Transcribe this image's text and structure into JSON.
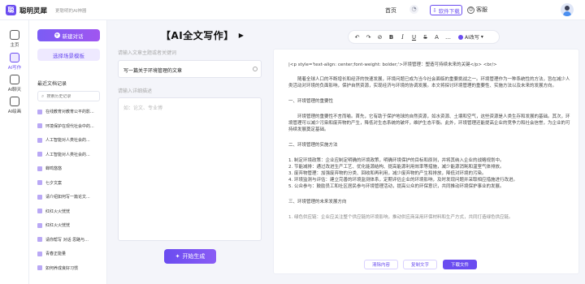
{
  "app": {
    "logo_char": "聪",
    "name": "聪明灵犀",
    "slogan": "更聪明的AI神器"
  },
  "topbar": {
    "home": "首页",
    "download": "软件下载",
    "kefu": "客服"
  },
  "rail": [
    {
      "label": "主页",
      "icon": "home-icon"
    },
    {
      "label": "AI写作",
      "icon": "pen-icon"
    },
    {
      "label": "AI聊天",
      "icon": "chat-icon"
    },
    {
      "label": "AI绘画",
      "icon": "paint-icon"
    }
  ],
  "history": {
    "new_chat": "新建对话",
    "choose_template": "选择场景模板",
    "title": "最近文档记录",
    "search_placeholder": "搜索历史记录",
    "items": [
      "在线教育对教育公平的影...",
      "环境保护在现代社会中的...",
      "人工智能对人类社会的...",
      "人工智能对人类社会的...",
      "蝉鸣悠悠",
      "七夕文案",
      "请介绍如何写一篇论文...",
      "红红火火恍恍",
      "红红火火恍恍",
      "请你帮写 对话 思路与...",
      "青春正能量",
      "如何养成良好习惯"
    ]
  },
  "main": {
    "title": "【AI全文写作】",
    "topic_label": "请输入文章主题或者关键词",
    "topic_value": "写一篇关于环境管理的文章",
    "desc_label": "请输入详细描述",
    "desc_placeholder": "如：论文、专业博",
    "generate": "开始生成"
  },
  "toolbar": {
    "ai_label": "AI改写"
  },
  "editor": {
    "code_line": "|<p style='text-align: center;font-weight: bolder;'>环境管理：塑造可持续未来的关键</p> <br/>",
    "paragraphs": [
      "随着全球人口的不断增长和经济的快速发展，环境问题已成为当今社会面临的重要挑战之一。环境管理作为一种系统性的方法，旨在减少人类活动对环境的负面影响，保护自然资源，实现经济与环境的协调发展。本文将探讨环境管理的重要性、实施方法以及未来的发展方向。"
    ],
    "heading1": "一、环境管理的重要性",
    "paragraph2": "环境管理的重要性不言而喻。首先，它有助于保护地球的自然资源，如水资源、土壤和空气，这些资源是人类生存和发展的基础。其次，环境管理可以减少污染和废弃物的产生，降低对生态系统的破坏，维护生态平衡。此外，环境管理还能提高企业的竞争力和社会信誉，为企业的可持续发展奠定基础。",
    "heading2": "二、环境管理的实施方法",
    "list": [
      "1. 制定环境政策：企业应制定明确的环境政策，明确环境保护的目标和原则，并将其纳入企业的战略规划中。",
      "2. 节能减排：通过改进生产工艺、优化能源结构、提高能源利用效率等措施，减少能源消耗和温室气体排放。",
      "3. 废弃物管理：加强废弃物的分类、回收和再利用，减少废弃物的产生和排放，降低对环境的污染。",
      "4. 环境监测与评估：建立完善的环境监测体系，定期评估企业的环境影响，及时发现问题并采取相应措施进行改进。",
      "5. 公众参与：鼓励员工和社区居民参与环境管理活动，提高公众的环保意识，共同推动环境保护事业的发展。"
    ],
    "heading3": "三、环境管理的未来发展方向",
    "tail": "1. 绿色供应链：企业应关注整个供应链的环境影响，推动供应商采用环保材料和生产方式，共同打造绿色供应链。",
    "btn_clear": "清除内容",
    "btn_copy": "复制文字",
    "btn_download": "下载文件"
  },
  "colors": {
    "accent": "#6a4cf0",
    "accent_light": "#eee9ff"
  }
}
